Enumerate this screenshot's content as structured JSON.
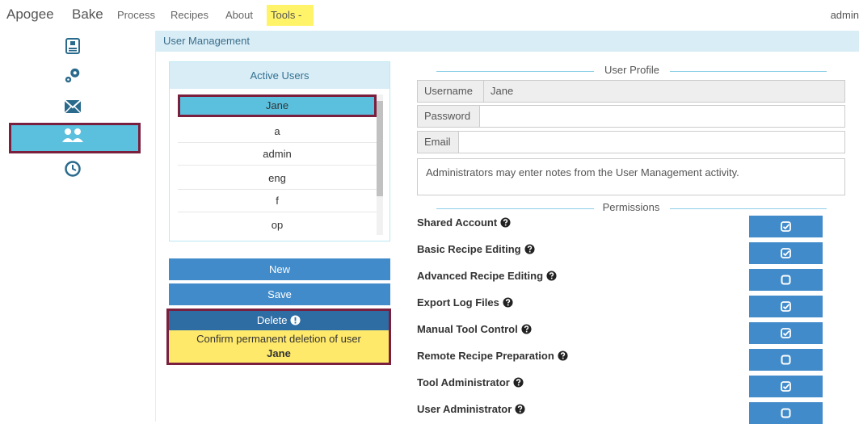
{
  "nav": {
    "brand_1": "Apogee",
    "brand_2": "Bake",
    "links": [
      "Process",
      "Recipes",
      "About"
    ],
    "tools_label": "Tools -",
    "user_label": "admin"
  },
  "sidebar": {
    "icons": [
      "clipboard-icon",
      "gears-icon",
      "envelope-icon",
      "users-icon",
      "clock-icon"
    ],
    "active_index": 3
  },
  "header": {
    "title": "User Management"
  },
  "users_panel": {
    "heading": "Active Users",
    "users": [
      "Jane",
      "a",
      "admin",
      "eng",
      "f",
      "op"
    ],
    "selected_index": 0
  },
  "actions": {
    "new_label": "New",
    "save_label": "Save",
    "delete_label": "Delete",
    "confirm_text": "Confirm permanent deletion of user",
    "confirm_user": "Jane"
  },
  "profile": {
    "section_title": "User Profile",
    "username_label": "Username",
    "username_value": "Jane",
    "password_label": "Password",
    "password_value": "",
    "email_label": "Email",
    "email_value": "",
    "notes_placeholder": "Administrators may enter notes from the User Management activity."
  },
  "permissions": {
    "section_title": "Permissions",
    "items": [
      {
        "label": "Shared Account",
        "checked": true
      },
      {
        "label": "Basic Recipe Editing",
        "checked": true
      },
      {
        "label": "Advanced Recipe Editing",
        "checked": false
      },
      {
        "label": "Export Log Files",
        "checked": true
      },
      {
        "label": "Manual Tool Control",
        "checked": true
      },
      {
        "label": "Remote Recipe Preparation",
        "checked": false
      },
      {
        "label": "Tool Administrator",
        "checked": true
      },
      {
        "label": "User Administrator",
        "checked": false
      }
    ]
  },
  "colors": {
    "accent": "#428bca",
    "highlight": "#5bc0de",
    "annotation_border": "#7a1f3d",
    "warning_bg": "#ffe96a"
  }
}
